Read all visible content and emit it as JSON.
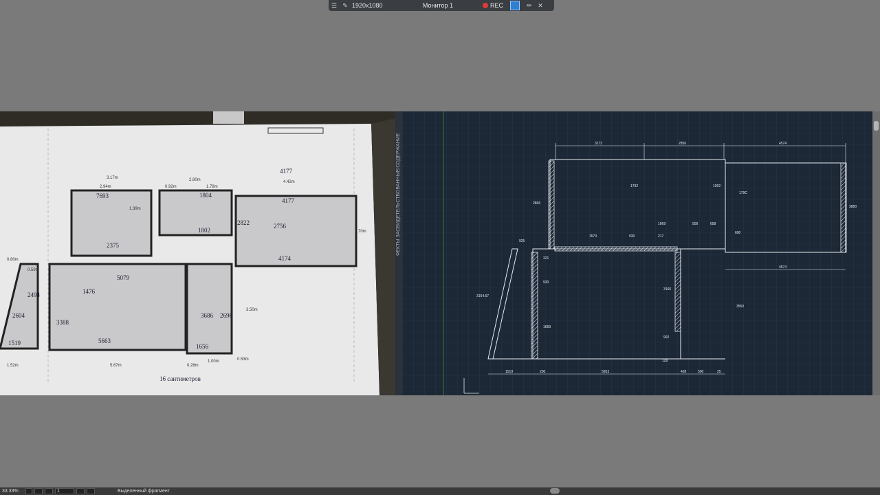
{
  "recorder": {
    "menu_icon": "menu-icon",
    "pin_icon": "pin-icon",
    "resolution": "1920x1080",
    "monitor": "Монитор 1",
    "rec_label": "REC",
    "region_icon": "region-select-icon",
    "pen_icon": "pen-icon",
    "close_icon": "close-icon",
    "accent": "#e03a3a"
  },
  "photo": {
    "notes": [
      "4177",
      "4177",
      "4174",
      "2822",
      "2756",
      "7693",
      "2375",
      "5079",
      "5663",
      "3388",
      "1476",
      "3686",
      "1656",
      "2696",
      "1802",
      "1804",
      "1519",
      "2604",
      "2494",
      "16 сантиметров"
    ],
    "measurements": [
      "3.17m",
      "2.94m",
      "0.92m",
      "2.80m",
      "1.78m",
      "4.42m",
      "0.80m",
      "0.59m",
      "1.39m",
      "3.50m",
      "5.67m",
      "1.00m",
      "0.53m",
      "1.52m",
      "0.28m",
      "1.70m"
    ]
  },
  "cad": {
    "top_dims": [
      "3173",
      "2856",
      "4574"
    ],
    "mid_dims": [
      "925",
      "1573",
      "930",
      "217",
      "1669",
      "500",
      "658",
      "1092",
      "1792",
      "3880",
      "179C",
      "2866",
      "600"
    ],
    "left_dims": [
      "3164.67",
      "1519",
      "200",
      "5853",
      "428",
      "500",
      "25"
    ],
    "side_dims": [
      "321",
      "930",
      "1669",
      "3166",
      "902",
      "128",
      "4574",
      "3550"
    ],
    "grid_color": "#2a3a4d",
    "line_color": "#e6ecf3"
  },
  "splitter": {
    "label": "ФЕКТЫ ЗАСВИДЕТЕЛЬСТВОВАННЫЕ/СОДЕРЖАНИЕ"
  },
  "status": {
    "zoom": "33.33%",
    "page": "1",
    "selection": "Выделенный фрагмент"
  }
}
